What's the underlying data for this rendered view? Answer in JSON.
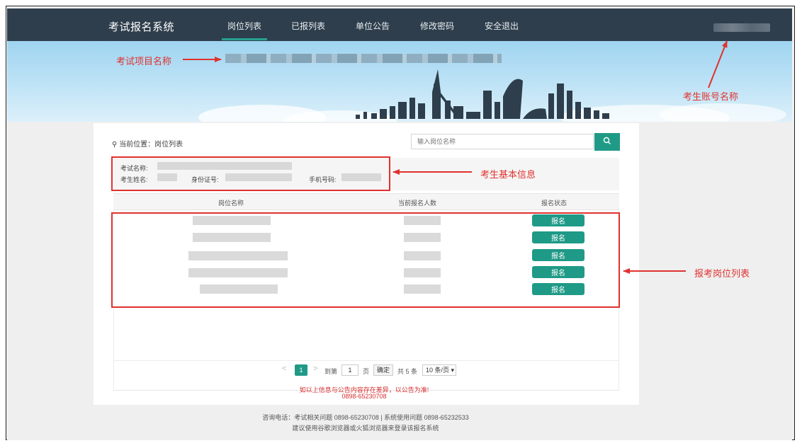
{
  "nav": {
    "brand": "考试报名系统",
    "items": [
      {
        "label": "岗位列表",
        "active": true
      },
      {
        "label": "已报列表"
      },
      {
        "label": "单位公告"
      },
      {
        "label": "修改密码"
      },
      {
        "label": "安全退出"
      }
    ]
  },
  "annotations": {
    "project_name": "考试项目名称",
    "account_name": "考生账号名称",
    "basic_info": "考生基本信息",
    "job_list": "报考岗位列表"
  },
  "breadcrumb": "当前位置：岗位列表",
  "search": {
    "placeholder": "输入岗位名称"
  },
  "info": {
    "exam_name_label": "考试名称:",
    "candidate_name_label": "考生姓名:",
    "id_label": "身份证号:",
    "phone_label": "手机号码:"
  },
  "table": {
    "columns": [
      "岗位名称",
      "当前报名人数",
      "报名状态"
    ],
    "rows": [
      {
        "action": "报名"
      },
      {
        "action": "报名"
      },
      {
        "action": "报名"
      },
      {
        "action": "报名"
      },
      {
        "action": "报名"
      }
    ]
  },
  "pagination": {
    "prev": "<",
    "current_page": "1",
    "next": ">",
    "goto_label": "到第",
    "page_input": "1",
    "page_unit": "页",
    "confirm": "确定",
    "total": "共 5 条",
    "page_size": "10 条/页"
  },
  "notice": {
    "line1": "如以上信息与公告内容存在差异，以公告为准!",
    "line2": "0898-65230708"
  },
  "footer": {
    "line1": "咨询电话：考试相关问题 0898-65230708 | 系统使用问题 0898-65232533",
    "line2": "建议使用谷歌浏览器或火狐浏览器来登录该报名系统"
  },
  "colors": {
    "nav_bg": "#2e3e4c",
    "accent": "#1f9a87",
    "annotation": "#e0322f"
  }
}
